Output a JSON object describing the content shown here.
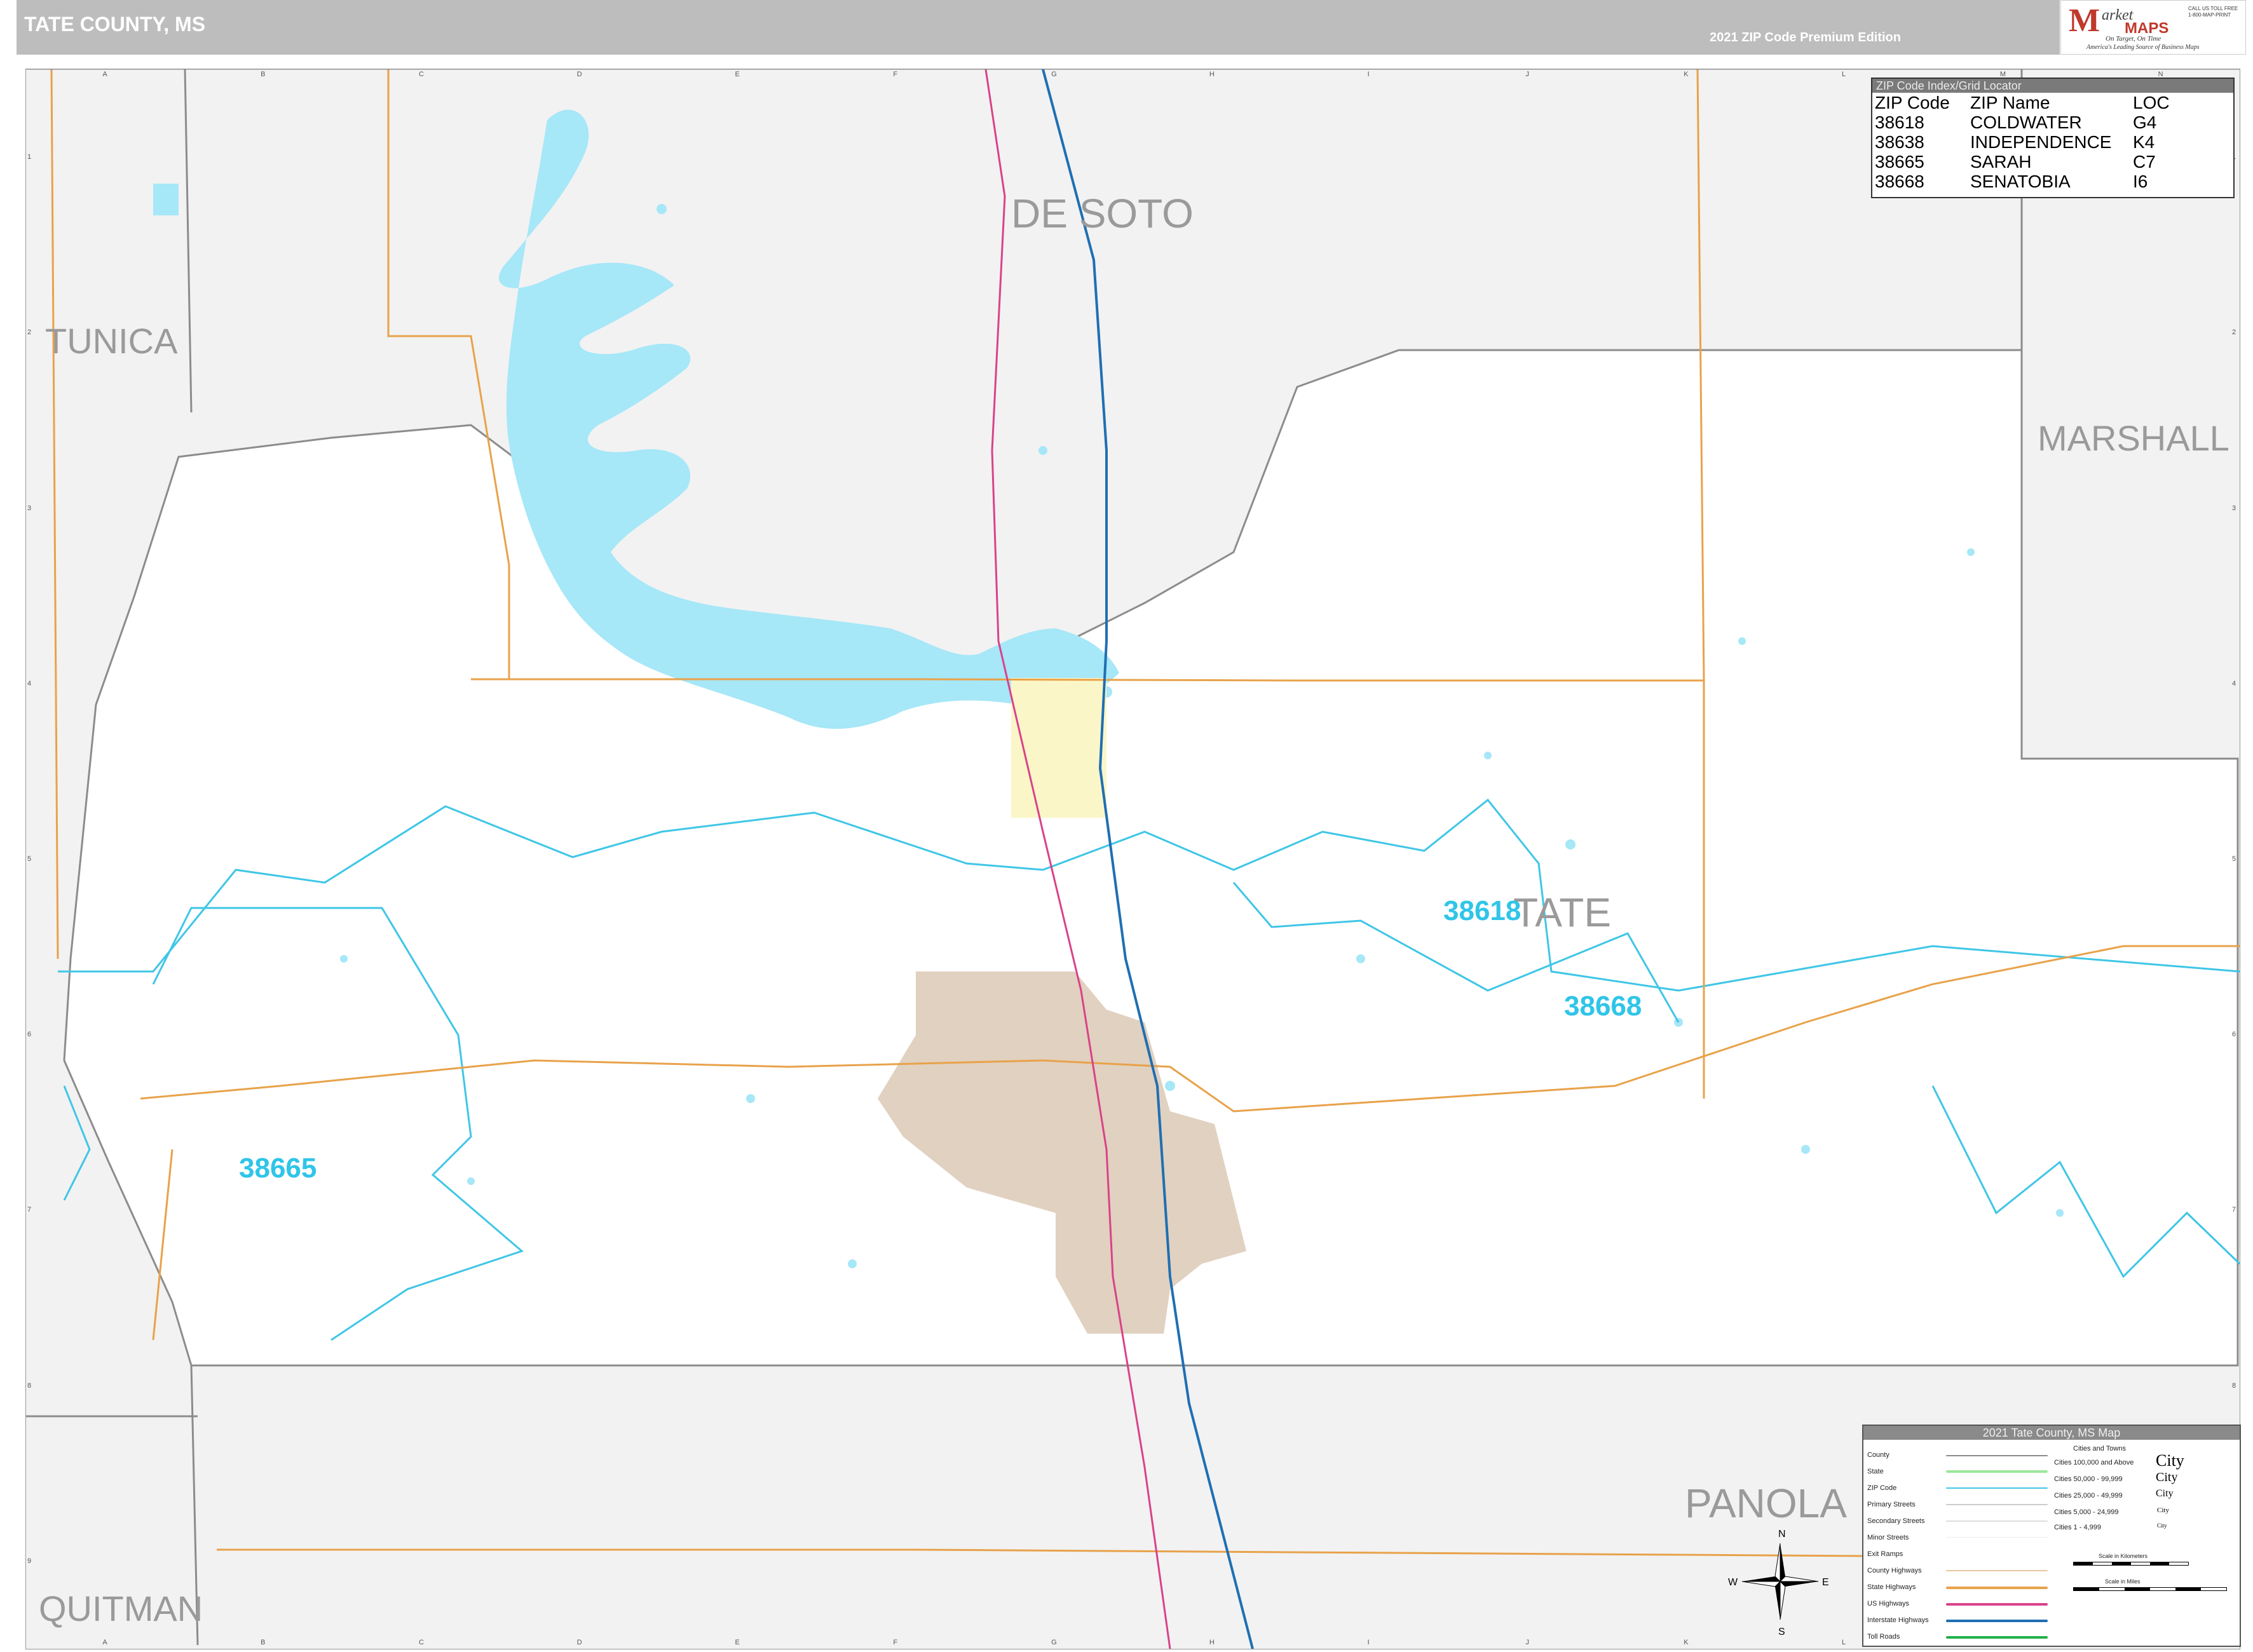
{
  "header": {
    "title": "TATE COUNTY, MS",
    "edition": "2021 ZIP Code Premium Edition"
  },
  "logo": {
    "mark": "M",
    "brand_small": "arket",
    "brand_maps": "MAPS",
    "tagline": "On Target, On Time",
    "tagline2": "America's Leading Source of Business Maps",
    "phone": "CALL US TOLL FREE 1-800-MAP-PRINT"
  },
  "grid": {
    "columns": [
      "A",
      "B",
      "C",
      "D",
      "E",
      "F",
      "G",
      "H",
      "I",
      "J",
      "K",
      "L",
      "M",
      "N"
    ],
    "rows": [
      "1",
      "2",
      "3",
      "4",
      "5",
      "6",
      "7",
      "8",
      "9"
    ]
  },
  "county_labels": {
    "desoto": "DE SOTO",
    "tunica": "TUNICA",
    "marshall": "MARSHALL",
    "tate": "TATE",
    "panola": "PANOLA",
    "quitman": "QUITMAN"
  },
  "zip_labels": {
    "z38618": "38618",
    "z38668": "38668",
    "z38665": "38665"
  },
  "zip_index": {
    "title": "ZIP Code Index/Grid Locator",
    "headers": [
      "ZIP Code",
      "ZIP Name",
      "LOC"
    ],
    "rows": [
      [
        "38618",
        "COLDWATER",
        "G4"
      ],
      [
        "38638",
        "INDEPENDENCE",
        "K4"
      ],
      [
        "38665",
        "SARAH",
        "C7"
      ],
      [
        "38668",
        "SENATOBIA",
        "I6"
      ]
    ]
  },
  "legend": {
    "title": "2021 Tate County, MS Map",
    "line_items": [
      "County",
      "State",
      "ZIP Code",
      "Primary Streets",
      "Secondary Streets",
      "Minor Streets",
      "Exit Ramps",
      "County Highways",
      "State Highways",
      "US Highways",
      "Interstate Highways",
      "Toll Roads"
    ],
    "cities_header": "Cities and Towns",
    "city_items": [
      "Cities 100,000 and Above",
      "Cities 50,000 - 99,999",
      "Cities 25,000 - 49,999",
      "Cities 5,000 - 24,999",
      "Cities 1 - 4,999"
    ],
    "city_samples": [
      "City",
      "City",
      "City",
      "City",
      "City"
    ],
    "scale_km": "Scale in Kilometers",
    "scale_mi": "Scale in Miles"
  },
  "compass": {
    "n": "N",
    "s": "S",
    "e": "E",
    "w": "W"
  },
  "colors": {
    "water": "#a6e7f8",
    "zip_boundary": "#3fc6e6",
    "county_boundary": "#8c8c8c",
    "interstate": "#1f6fb2",
    "us_highway": "#d9428a",
    "state_highway": "#e8a24a",
    "senatobia_area": "#e1d1c0",
    "coldwater_area": "#fbf6c8",
    "outside_county": "#f2f2f2"
  }
}
